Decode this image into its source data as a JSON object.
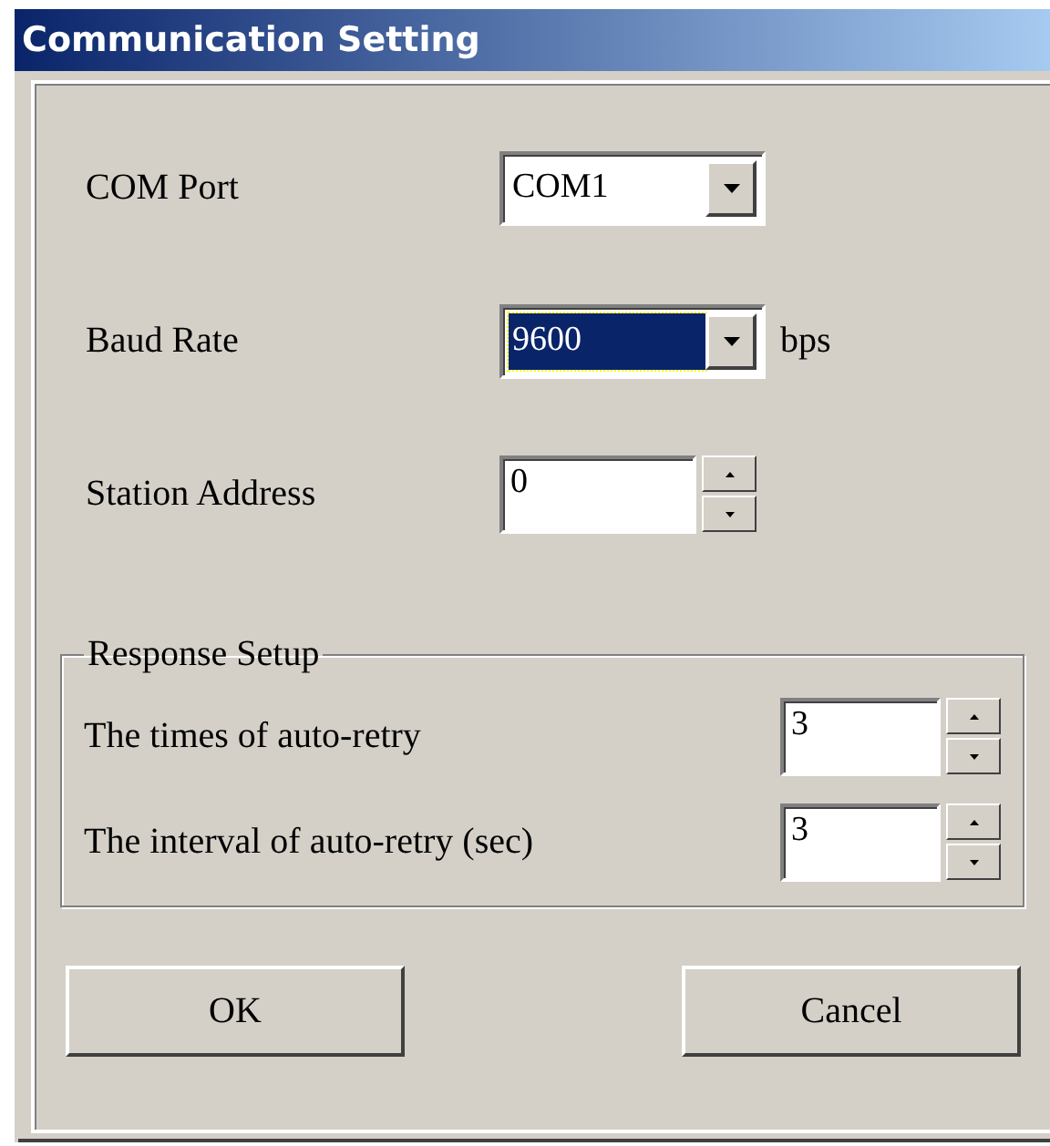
{
  "window": {
    "title": "Communication Setting"
  },
  "fields": [
    {
      "kind": "combo",
      "label": "COM Port",
      "value": "COM1",
      "selected": false
    },
    {
      "kind": "combo",
      "label": "Baud Rate",
      "value": "9600",
      "selected": true,
      "unit": "bps"
    },
    {
      "kind": "spin",
      "label": "Station Address",
      "value": "0"
    }
  ],
  "response_setup": {
    "title": "Response Setup",
    "fields": [
      {
        "kind": "spin",
        "label": "The times of auto-retry",
        "value": "3"
      },
      {
        "kind": "spin",
        "label": "The interval of auto-retry (sec)",
        "value": "3"
      }
    ]
  },
  "buttons": [
    "OK",
    "Cancel"
  ]
}
